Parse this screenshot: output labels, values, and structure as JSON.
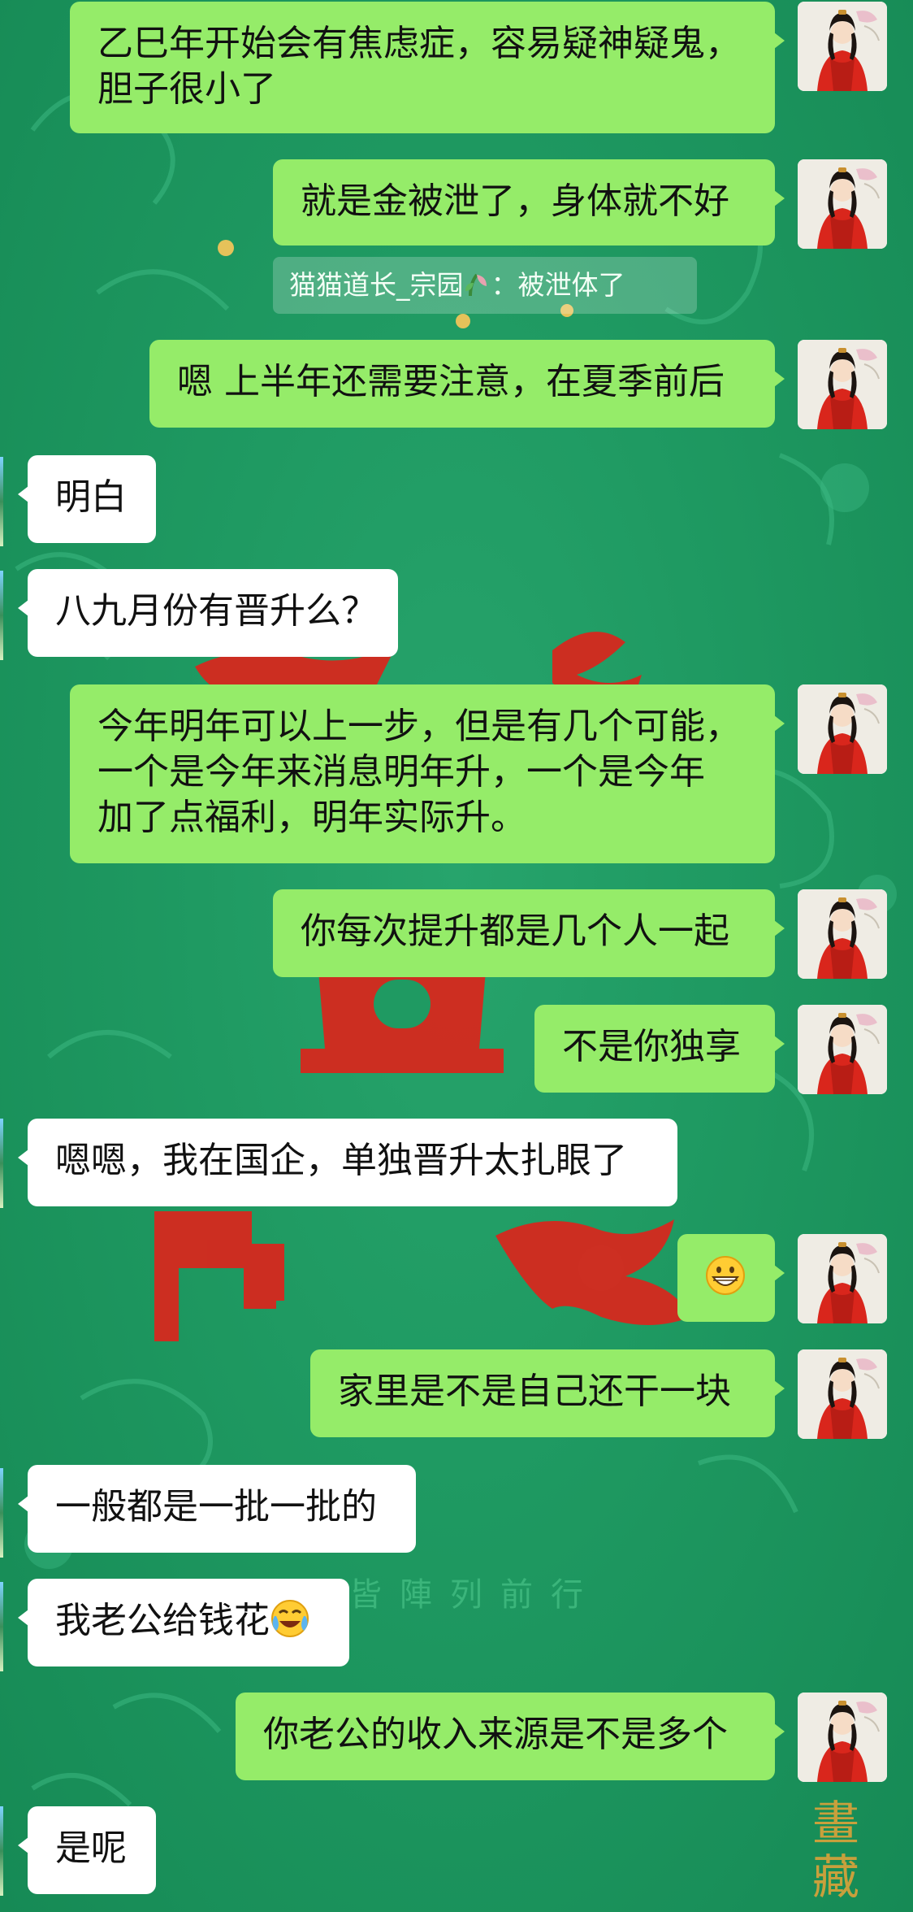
{
  "background": {
    "primary_color": "#1f9a62",
    "accent_color": "#d6281e",
    "gold_text": "皆陣列前行",
    "side_text": "畫藏"
  },
  "messages": [
    {
      "id": "m1",
      "side": "sent",
      "lines": [
        "乙巳年开始会有焦虑症，容易疑神疑鬼，",
        "胆子很小了"
      ]
    },
    {
      "id": "m2",
      "side": "sent",
      "lines": [
        "就是金被泄了，身体就不好"
      ]
    },
    {
      "id": "m3",
      "side": "sent",
      "lines": [
        "嗯 上半年还需要注意，在夏季前后"
      ]
    },
    {
      "id": "m4",
      "side": "recv",
      "lines": [
        "明白"
      ]
    },
    {
      "id": "m5",
      "side": "recv",
      "lines": [
        "八九月份有晋升么？"
      ]
    },
    {
      "id": "m6",
      "side": "sent",
      "lines": [
        "今年明年可以上一步，但是有几个可能，",
        "一个是今年来消息明年升，一个是今年",
        "加了点福利，明年实际升。"
      ]
    },
    {
      "id": "m7",
      "side": "sent",
      "lines": [
        "你每次提升都是几个人一起"
      ]
    },
    {
      "id": "m8",
      "side": "sent",
      "lines": [
        "不是你独享"
      ]
    },
    {
      "id": "m9",
      "side": "recv",
      "lines": [
        "嗯嗯，我在国企，单独晋升太扎眼了"
      ]
    },
    {
      "id": "m10",
      "side": "sent",
      "lines": [
        ""
      ],
      "emoji": "grinning-face-icon"
    },
    {
      "id": "m11",
      "side": "sent",
      "lines": [
        "家里是不是自己还干一块"
      ]
    },
    {
      "id": "m12",
      "side": "recv",
      "lines": [
        "一般都是一批一批的"
      ]
    },
    {
      "id": "m13",
      "side": "recv",
      "lines": [
        "我老公给钱花"
      ],
      "emoji": "laughing-crying-face-icon"
    },
    {
      "id": "m14",
      "side": "sent",
      "lines": [
        "你老公的收入来源是不是多个"
      ]
    },
    {
      "id": "m15",
      "side": "recv",
      "lines": [
        "是呢"
      ]
    }
  ],
  "quote": {
    "sender": "猫猫道长_宗园",
    "separator": "：",
    "text": "被泄体了",
    "icon": "sprout-icon"
  },
  "avatar": {
    "icon": "woman-in-red-robe-avatar-icon"
  }
}
